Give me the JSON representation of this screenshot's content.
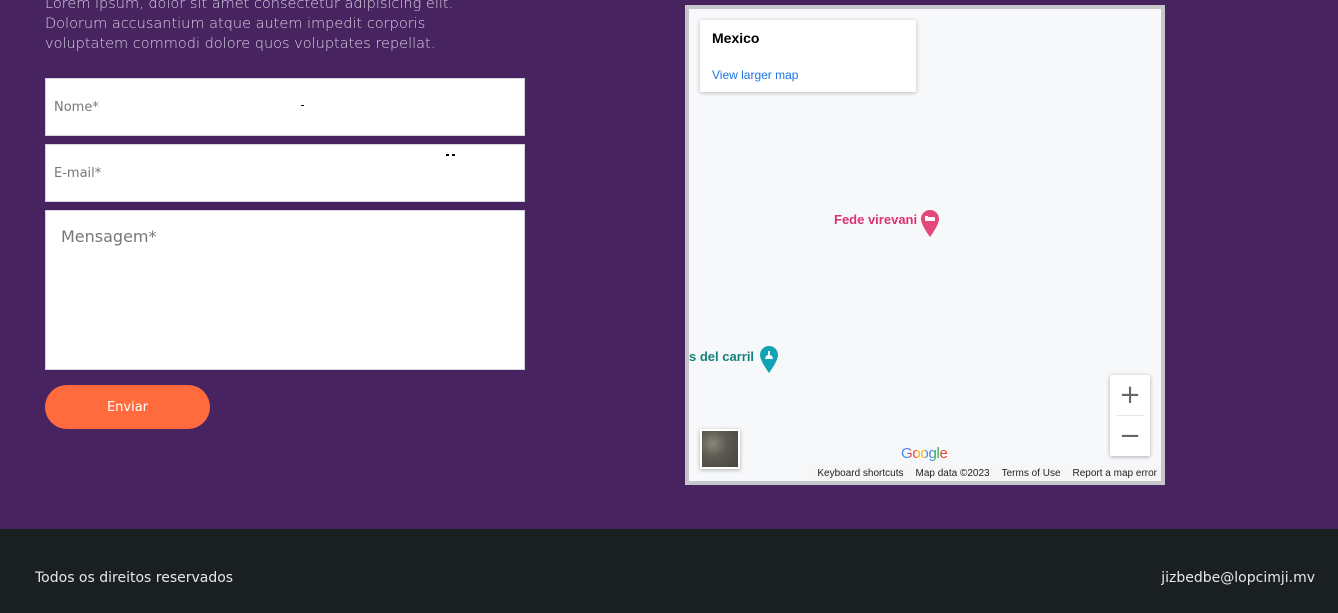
{
  "intro": {
    "line1": "Lorem ipsum, dolor sit amet consectetur adipisicing elit.",
    "line2": "Dolorum accusantium atque autem impedit corporis",
    "line3": "voluptatem commodi dolore quos voluptates repellat."
  },
  "form": {
    "name_placeholder": "Nome*",
    "email_placeholder": "E-mail*",
    "message_placeholder": "Mensagem*",
    "submit_label": "Enviar"
  },
  "map": {
    "place_title": "Mexico",
    "larger_map_link": "View larger map",
    "poi_hotel": "Fede virevani",
    "poi_park": "s del carril",
    "zoom_in": "+",
    "zoom_out": "−",
    "logo": "Google",
    "keyboard_shortcuts": "Keyboard shortcuts",
    "map_data": "Map data ©2023",
    "terms": "Terms of Use",
    "report": "Report a map error"
  },
  "footer": {
    "copyright": "Todos os direitos reservados",
    "email": "jizbedbe@lopcimji.mv"
  },
  "colors": {
    "background": "#472460",
    "accent_button": "#ff6b3d",
    "footer_background": "#1a2022",
    "map_link": "#1a73e8",
    "hotel_pin": "#e2487a",
    "park_pin": "#12a3b4"
  },
  "icons": {
    "hotel_pin": "hotel-pin-icon",
    "park_pin": "park-pin-icon",
    "zoom_in": "plus-icon",
    "zoom_out": "minus-icon"
  }
}
